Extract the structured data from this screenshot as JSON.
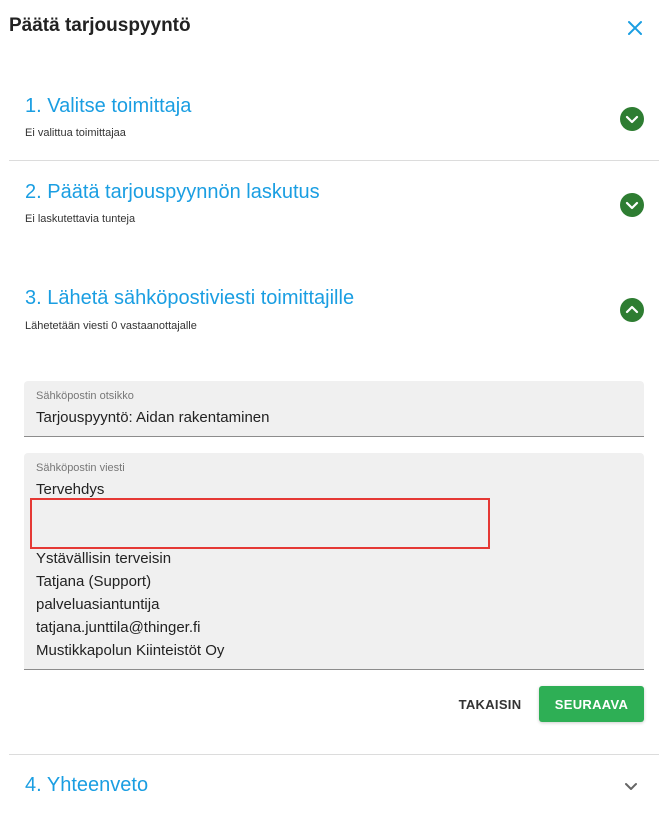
{
  "dialog": {
    "title": "Päätä tarjouspyyntö"
  },
  "steps": [
    {
      "title": "1. Valitse toimittaja",
      "subtitle": "Ei valittua toimittajaa",
      "state": "collapsed"
    },
    {
      "title": "2. Päätä tarjouspyynnön laskutus",
      "subtitle": "Ei laskutettavia tunteja",
      "state": "collapsed"
    },
    {
      "title": "3. Lähetä sähköpostiviesti toimittajille",
      "subtitle": "Lähetetään viesti 0 vastaanottajalle",
      "state": "expanded"
    },
    {
      "title": "4. Yhteenveto",
      "subtitle": "",
      "state": "collapsed"
    }
  ],
  "email": {
    "subject_label": "Sähköpostin otsikko",
    "subject_value": "Tarjouspyyntö: Aidan rakentaminen",
    "message_label": "Sähköpostin viesti",
    "message_lines": [
      "Tervehdys",
      "",
      "",
      "Ystävällisin terveisin",
      "Tatjana (Support)",
      "palveluasiantuntija",
      "tatjana.junttila@thinger.fi",
      "Mustikkapolun Kiinteistöt Oy"
    ]
  },
  "buttons": {
    "back": "TAKAISIN",
    "next": "SEURAAVA"
  },
  "colors": {
    "accent": "#1a9ee2",
    "badge": "#2e7d32",
    "primary_button": "#2eaf55",
    "highlight": "#e53935"
  },
  "icons": {
    "close": "close-icon",
    "expand": "chevron-down-icon",
    "collapse": "chevron-up-icon"
  }
}
